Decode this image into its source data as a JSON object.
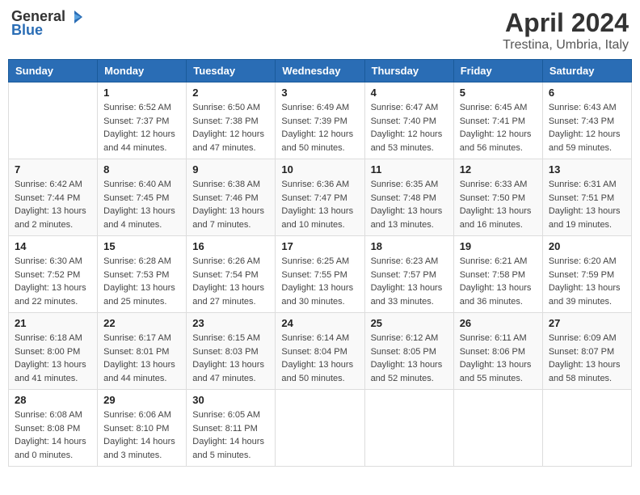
{
  "logo": {
    "general": "General",
    "blue": "Blue"
  },
  "header": {
    "month": "April 2024",
    "location": "Trestina, Umbria, Italy"
  },
  "weekdays": [
    "Sunday",
    "Monday",
    "Tuesday",
    "Wednesday",
    "Thursday",
    "Friday",
    "Saturday"
  ],
  "weeks": [
    [
      {
        "day": "",
        "sunrise": "",
        "sunset": "",
        "daylight": ""
      },
      {
        "day": "1",
        "sunrise": "Sunrise: 6:52 AM",
        "sunset": "Sunset: 7:37 PM",
        "daylight": "Daylight: 12 hours and 44 minutes."
      },
      {
        "day": "2",
        "sunrise": "Sunrise: 6:50 AM",
        "sunset": "Sunset: 7:38 PM",
        "daylight": "Daylight: 12 hours and 47 minutes."
      },
      {
        "day": "3",
        "sunrise": "Sunrise: 6:49 AM",
        "sunset": "Sunset: 7:39 PM",
        "daylight": "Daylight: 12 hours and 50 minutes."
      },
      {
        "day": "4",
        "sunrise": "Sunrise: 6:47 AM",
        "sunset": "Sunset: 7:40 PM",
        "daylight": "Daylight: 12 hours and 53 minutes."
      },
      {
        "day": "5",
        "sunrise": "Sunrise: 6:45 AM",
        "sunset": "Sunset: 7:41 PM",
        "daylight": "Daylight: 12 hours and 56 minutes."
      },
      {
        "day": "6",
        "sunrise": "Sunrise: 6:43 AM",
        "sunset": "Sunset: 7:43 PM",
        "daylight": "Daylight: 12 hours and 59 minutes."
      }
    ],
    [
      {
        "day": "7",
        "sunrise": "Sunrise: 6:42 AM",
        "sunset": "Sunset: 7:44 PM",
        "daylight": "Daylight: 13 hours and 2 minutes."
      },
      {
        "day": "8",
        "sunrise": "Sunrise: 6:40 AM",
        "sunset": "Sunset: 7:45 PM",
        "daylight": "Daylight: 13 hours and 4 minutes."
      },
      {
        "day": "9",
        "sunrise": "Sunrise: 6:38 AM",
        "sunset": "Sunset: 7:46 PM",
        "daylight": "Daylight: 13 hours and 7 minutes."
      },
      {
        "day": "10",
        "sunrise": "Sunrise: 6:36 AM",
        "sunset": "Sunset: 7:47 PM",
        "daylight": "Daylight: 13 hours and 10 minutes."
      },
      {
        "day": "11",
        "sunrise": "Sunrise: 6:35 AM",
        "sunset": "Sunset: 7:48 PM",
        "daylight": "Daylight: 13 hours and 13 minutes."
      },
      {
        "day": "12",
        "sunrise": "Sunrise: 6:33 AM",
        "sunset": "Sunset: 7:50 PM",
        "daylight": "Daylight: 13 hours and 16 minutes."
      },
      {
        "day": "13",
        "sunrise": "Sunrise: 6:31 AM",
        "sunset": "Sunset: 7:51 PM",
        "daylight": "Daylight: 13 hours and 19 minutes."
      }
    ],
    [
      {
        "day": "14",
        "sunrise": "Sunrise: 6:30 AM",
        "sunset": "Sunset: 7:52 PM",
        "daylight": "Daylight: 13 hours and 22 minutes."
      },
      {
        "day": "15",
        "sunrise": "Sunrise: 6:28 AM",
        "sunset": "Sunset: 7:53 PM",
        "daylight": "Daylight: 13 hours and 25 minutes."
      },
      {
        "day": "16",
        "sunrise": "Sunrise: 6:26 AM",
        "sunset": "Sunset: 7:54 PM",
        "daylight": "Daylight: 13 hours and 27 minutes."
      },
      {
        "day": "17",
        "sunrise": "Sunrise: 6:25 AM",
        "sunset": "Sunset: 7:55 PM",
        "daylight": "Daylight: 13 hours and 30 minutes."
      },
      {
        "day": "18",
        "sunrise": "Sunrise: 6:23 AM",
        "sunset": "Sunset: 7:57 PM",
        "daylight": "Daylight: 13 hours and 33 minutes."
      },
      {
        "day": "19",
        "sunrise": "Sunrise: 6:21 AM",
        "sunset": "Sunset: 7:58 PM",
        "daylight": "Daylight: 13 hours and 36 minutes."
      },
      {
        "day": "20",
        "sunrise": "Sunrise: 6:20 AM",
        "sunset": "Sunset: 7:59 PM",
        "daylight": "Daylight: 13 hours and 39 minutes."
      }
    ],
    [
      {
        "day": "21",
        "sunrise": "Sunrise: 6:18 AM",
        "sunset": "Sunset: 8:00 PM",
        "daylight": "Daylight: 13 hours and 41 minutes."
      },
      {
        "day": "22",
        "sunrise": "Sunrise: 6:17 AM",
        "sunset": "Sunset: 8:01 PM",
        "daylight": "Daylight: 13 hours and 44 minutes."
      },
      {
        "day": "23",
        "sunrise": "Sunrise: 6:15 AM",
        "sunset": "Sunset: 8:03 PM",
        "daylight": "Daylight: 13 hours and 47 minutes."
      },
      {
        "day": "24",
        "sunrise": "Sunrise: 6:14 AM",
        "sunset": "Sunset: 8:04 PM",
        "daylight": "Daylight: 13 hours and 50 minutes."
      },
      {
        "day": "25",
        "sunrise": "Sunrise: 6:12 AM",
        "sunset": "Sunset: 8:05 PM",
        "daylight": "Daylight: 13 hours and 52 minutes."
      },
      {
        "day": "26",
        "sunrise": "Sunrise: 6:11 AM",
        "sunset": "Sunset: 8:06 PM",
        "daylight": "Daylight: 13 hours and 55 minutes."
      },
      {
        "day": "27",
        "sunrise": "Sunrise: 6:09 AM",
        "sunset": "Sunset: 8:07 PM",
        "daylight": "Daylight: 13 hours and 58 minutes."
      }
    ],
    [
      {
        "day": "28",
        "sunrise": "Sunrise: 6:08 AM",
        "sunset": "Sunset: 8:08 PM",
        "daylight": "Daylight: 14 hours and 0 minutes."
      },
      {
        "day": "29",
        "sunrise": "Sunrise: 6:06 AM",
        "sunset": "Sunset: 8:10 PM",
        "daylight": "Daylight: 14 hours and 3 minutes."
      },
      {
        "day": "30",
        "sunrise": "Sunrise: 6:05 AM",
        "sunset": "Sunset: 8:11 PM",
        "daylight": "Daylight: 14 hours and 5 minutes."
      },
      {
        "day": "",
        "sunrise": "",
        "sunset": "",
        "daylight": ""
      },
      {
        "day": "",
        "sunrise": "",
        "sunset": "",
        "daylight": ""
      },
      {
        "day": "",
        "sunrise": "",
        "sunset": "",
        "daylight": ""
      },
      {
        "day": "",
        "sunrise": "",
        "sunset": "",
        "daylight": ""
      }
    ]
  ]
}
